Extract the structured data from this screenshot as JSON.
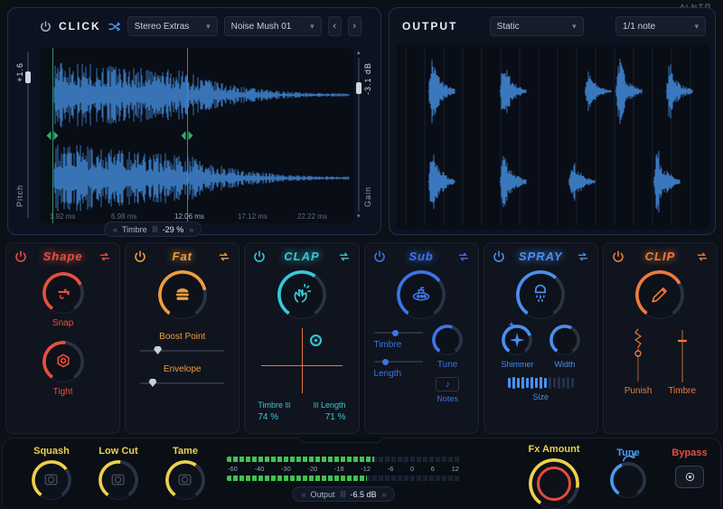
{
  "colors": {
    "yellow": "#edd14b",
    "green": "#3fc24e",
    "red": "#e64b3e",
    "lightblue": "#4a9af5",
    "wave": "#3d7ec6",
    "marker": "#2fae6e",
    "crosshair": "#e8743c"
  },
  "click": {
    "title": "CLICK",
    "preset_bank": "Stereo Extras",
    "preset_name": "Noise Mush 01",
    "pitch_label": "Pitch",
    "pitch_value": "+1.6",
    "gain_label": "Gain",
    "gain_value": "-3.1 dB",
    "time_labels": [
      "1.92 ms",
      "6.98 ms",
      "12.06 ms",
      "17.12 ms",
      "22.22 ms"
    ],
    "timbre_label": "Timbre",
    "timbre_value": "-29 %"
  },
  "output": {
    "title": "OUTPUT",
    "mode": "Static",
    "rate": "1/1 note"
  },
  "modules": [
    {
      "name": "Shape",
      "color": "#e8503c",
      "controls": [
        {
          "label": "Snap"
        },
        {
          "label": "Tight"
        }
      ]
    },
    {
      "name": "Fat",
      "color": "#f09c3c",
      "controls": [
        {
          "label": "Boost Point"
        },
        {
          "label": "Envelope"
        }
      ]
    },
    {
      "name": "CLAP",
      "color": "#38c8d8",
      "controls": [
        {
          "label": "Timbre",
          "value": "74 %"
        },
        {
          "label": "Length",
          "value": "71 %"
        }
      ]
    },
    {
      "name": "Sub",
      "color": "#3d74e8",
      "controls": [
        {
          "label": "Timbre"
        },
        {
          "label": "Length"
        },
        {
          "label": "Tune"
        },
        {
          "label": "Notes"
        }
      ]
    },
    {
      "name": "SPRAY",
      "color": "#4a8ff0",
      "controls": [
        {
          "label": "Shimmer"
        },
        {
          "label": "Width"
        },
        {
          "label": "Size"
        }
      ]
    },
    {
      "name": "CLIP",
      "color": "#ef7a3a",
      "controls": [
        {
          "label": "Punish"
        },
        {
          "label": "Timbre"
        }
      ]
    }
  ],
  "bottom": {
    "knobs": [
      "Squash",
      "Low Cut",
      "Tame"
    ],
    "meter_scale": [
      "-60",
      "-40",
      "-30",
      "-20",
      "-18",
      "-12",
      "-6",
      "0",
      "6",
      "12"
    ],
    "output_label": "Output",
    "output_value": "-6.5 dB",
    "fx_amount_label": "Fx Amount",
    "tune_label": "Tune",
    "bypass_label": "Bypass"
  }
}
